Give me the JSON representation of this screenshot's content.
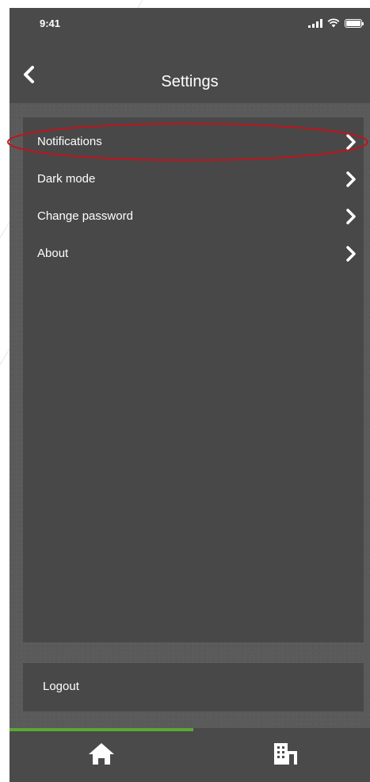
{
  "status_bar": {
    "time": "9:41",
    "icons": [
      "signal-icon",
      "wifi-icon",
      "battery-icon"
    ]
  },
  "header": {
    "title": "Settings",
    "back_icon": "chevron-left-icon"
  },
  "menu": {
    "items": [
      {
        "label": "Notifications",
        "icon": "chevron-right-icon"
      },
      {
        "label": "Dark mode",
        "icon": "chevron-right-icon"
      },
      {
        "label": "Change password",
        "icon": "chevron-right-icon"
      },
      {
        "label": "About",
        "icon": "chevron-right-icon"
      }
    ]
  },
  "logout": {
    "label": "Logout"
  },
  "tab_bar": {
    "tabs": [
      {
        "icon": "home-icon",
        "active": true
      },
      {
        "icon": "buildings-icon",
        "active": false
      }
    ],
    "active_color": "#5aa832"
  },
  "annotation": {
    "highlight_color": "#c0141c"
  }
}
